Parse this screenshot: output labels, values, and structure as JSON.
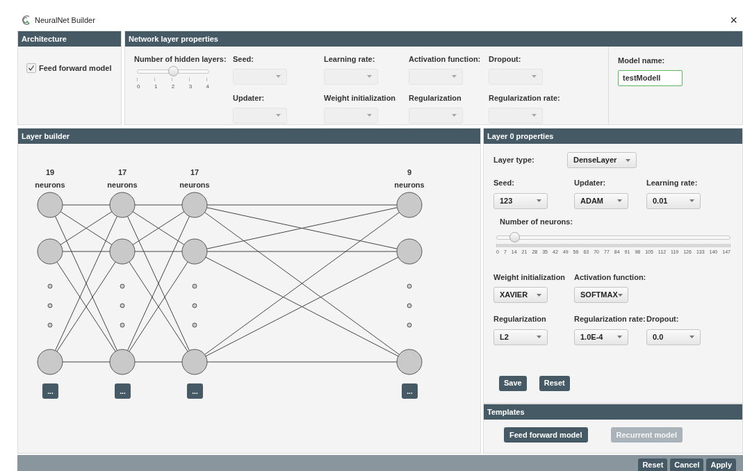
{
  "window": {
    "title": "NeuralNet Builder",
    "close": "×"
  },
  "architecture": {
    "title": "Architecture",
    "option": {
      "label": "Feed forward model",
      "checked": true
    }
  },
  "network_properties": {
    "title": "Network layer properties",
    "hidden_layers": {
      "label": "Number of hidden layers:",
      "level": 0.5,
      "ticks": [
        "0",
        "1",
        "2",
        "3",
        "4"
      ]
    },
    "fields": [
      {
        "label": "Seed:",
        "disabled": true
      },
      {
        "label": "Learning rate:",
        "disabled": true
      },
      {
        "label": "Activation function:",
        "disabled": true
      },
      {
        "label": "Dropout:",
        "disabled": true
      },
      {
        "label": "Updater:",
        "disabled": true
      },
      {
        "label": "Weight initialization",
        "disabled": true
      },
      {
        "label": "Regularization",
        "disabled": true
      },
      {
        "label": "Regularization rate:",
        "disabled": true
      }
    ],
    "model_name": {
      "label": "Model name:",
      "value": "testModell"
    }
  },
  "layer_builder": {
    "title": "Layer builder",
    "layers": [
      {
        "count": "19",
        "unit": "neurons",
        "button": "..."
      },
      {
        "count": "17",
        "unit": "neurons",
        "button": "..."
      },
      {
        "count": "17",
        "unit": "neurons",
        "button": "..."
      },
      {
        "count": "9",
        "unit": "neurons",
        "button": "..."
      }
    ]
  },
  "layer_properties": {
    "title": "Layer 0 properties",
    "layer_type": {
      "label": "Layer type:",
      "value": "DenseLayer"
    },
    "field_rows": [
      [
        {
          "label": "Seed:",
          "value": "123"
        },
        {
          "label": "Updater:",
          "value": "ADAM"
        },
        {
          "label": "Learning rate:",
          "value": "0.01"
        }
      ],
      [
        {
          "label": "Weight initialization",
          "value": "XAVIER"
        },
        {
          "label": "Activation function:",
          "value": "SOFTMAX"
        }
      ],
      [
        {
          "label": "Regularization",
          "value": "L2"
        },
        {
          "label": "Regularization rate:",
          "value": "1.0E-4"
        },
        {
          "label": "Dropout:",
          "value": "0.0"
        }
      ]
    ],
    "neurons": {
      "label": "Number of neurons:",
      "level": 0.06,
      "ticks": [
        "0",
        "7",
        "14",
        "21",
        "28",
        "35",
        "42",
        "49",
        "56",
        "63",
        "70",
        "77",
        "84",
        "91",
        "98",
        "105",
        "112",
        "119",
        "126",
        "133",
        "140",
        "147"
      ]
    },
    "buttons": [
      "Save",
      "Reset"
    ]
  },
  "templates": {
    "title": "Templates",
    "buttons": [
      {
        "label": "Feed forward model",
        "disabled": false
      },
      {
        "label": "Recurrent model",
        "disabled": true
      }
    ]
  },
  "footer": {
    "buttons": [
      "Reset",
      "Cancel",
      "Apply"
    ]
  }
}
